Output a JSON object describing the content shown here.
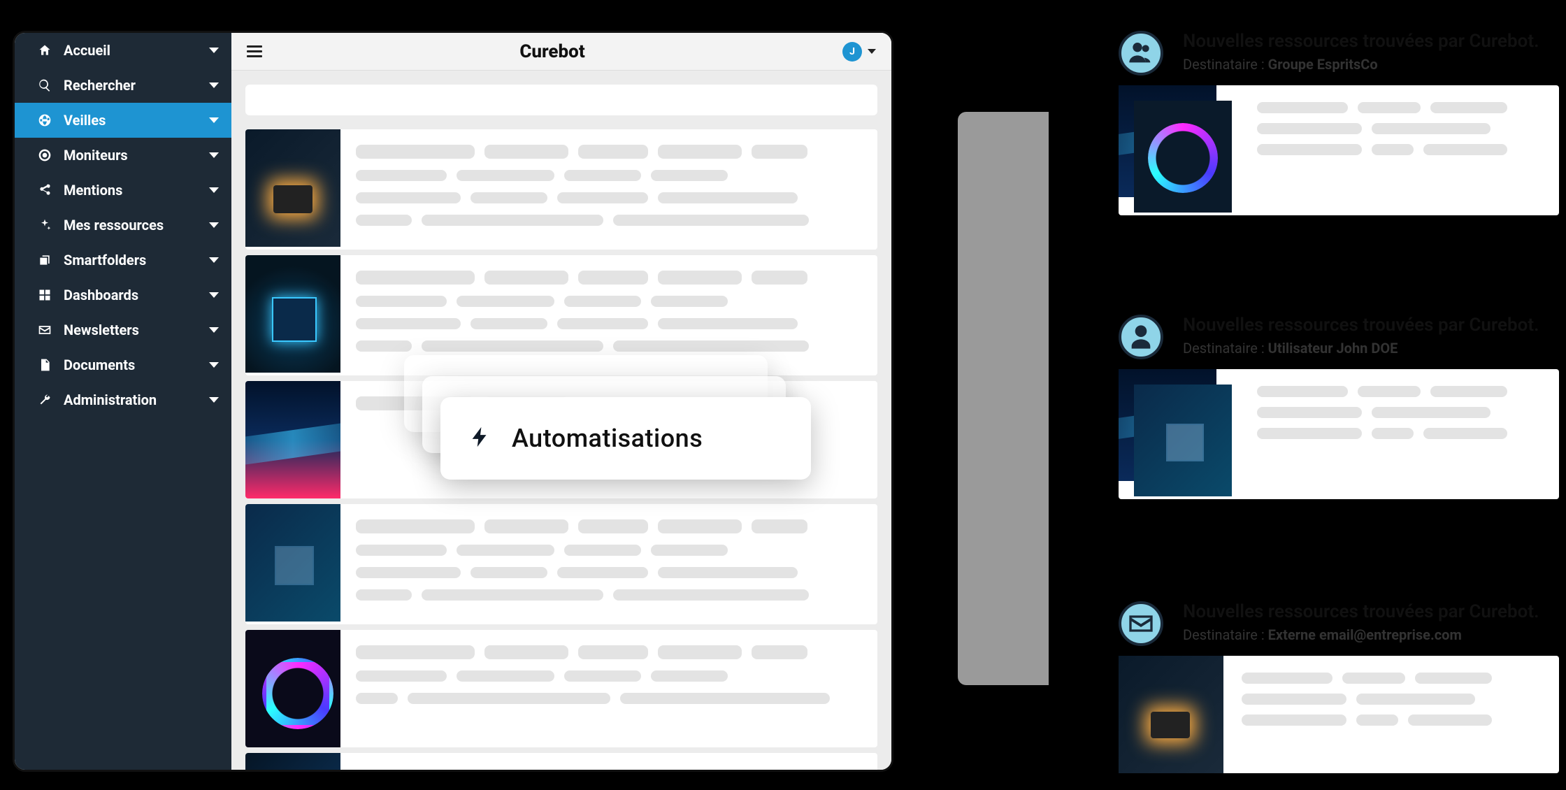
{
  "app": {
    "brand": "Curebot",
    "user_initial": "J"
  },
  "sidebar": {
    "items": [
      {
        "label": "Accueil",
        "icon": "home"
      },
      {
        "label": "Rechercher",
        "icon": "search"
      },
      {
        "label": "Veilles",
        "icon": "globe",
        "active": true
      },
      {
        "label": "Moniteurs",
        "icon": "target"
      },
      {
        "label": "Mentions",
        "icon": "share"
      },
      {
        "label": "Mes ressources",
        "icon": "sparkle"
      },
      {
        "label": "Smartfolders",
        "icon": "copy"
      },
      {
        "label": "Dashboards",
        "icon": "grid"
      },
      {
        "label": "Newsletters",
        "icon": "mail"
      },
      {
        "label": "Documents",
        "icon": "doc"
      },
      {
        "label": "Administration",
        "icon": "wrench"
      }
    ]
  },
  "automations": {
    "title": "Automatisations"
  },
  "notifications": [
    {
      "title": "Nouvelles ressources trouvées par Curebot.",
      "recipient_prefix": "Destinataire : ",
      "recipient_value": "Groupe EspritsCo",
      "avatar": "group"
    },
    {
      "title": "Nouvelles ressources trouvées par Curebot.",
      "recipient_prefix": "Destinataire : ",
      "recipient_value": "Utilisateur John DOE",
      "avatar": "user"
    },
    {
      "title": "Nouvelles ressources trouvées par Curebot.",
      "recipient_prefix": "Destinataire : ",
      "recipient_label": "Externe ",
      "recipient_value": "email@entreprise.com",
      "avatar": "mail"
    }
  ]
}
